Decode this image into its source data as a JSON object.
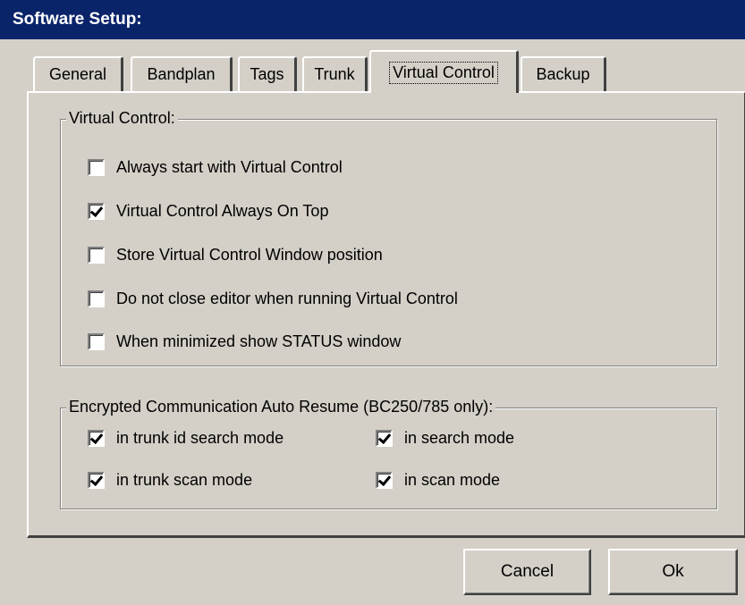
{
  "window": {
    "title": "Software Setup:"
  },
  "tabs": [
    {
      "label": "General",
      "active": false
    },
    {
      "label": "Bandplan",
      "active": false
    },
    {
      "label": "Tags",
      "active": false
    },
    {
      "label": "Trunk",
      "active": false
    },
    {
      "label": "Virtual Control",
      "active": true
    },
    {
      "label": "Backup",
      "active": false
    }
  ],
  "virtual_control": {
    "title": "Virtual Control:",
    "options": [
      {
        "label": "Always start with Virtual Control",
        "checked": false
      },
      {
        "label": "Virtual Control Always On Top",
        "checked": true
      },
      {
        "label": "Store Virtual Control Window position",
        "checked": false
      },
      {
        "label": "Do not close editor when running Virtual Control",
        "checked": false
      },
      {
        "label": "When minimized show STATUS window",
        "checked": false
      }
    ]
  },
  "encrypted": {
    "title": "Encrypted Communication Auto Resume (BC250/785 only):",
    "options": [
      {
        "label": "in trunk id search mode",
        "checked": true
      },
      {
        "label": "in search mode",
        "checked": true
      },
      {
        "label": "in trunk scan mode",
        "checked": true
      },
      {
        "label": "in scan mode",
        "checked": true
      }
    ]
  },
  "buttons": {
    "cancel": "Cancel",
    "ok": "Ok"
  },
  "colors": {
    "titlebar": "#0a246a",
    "face": "#d4d0c8"
  }
}
